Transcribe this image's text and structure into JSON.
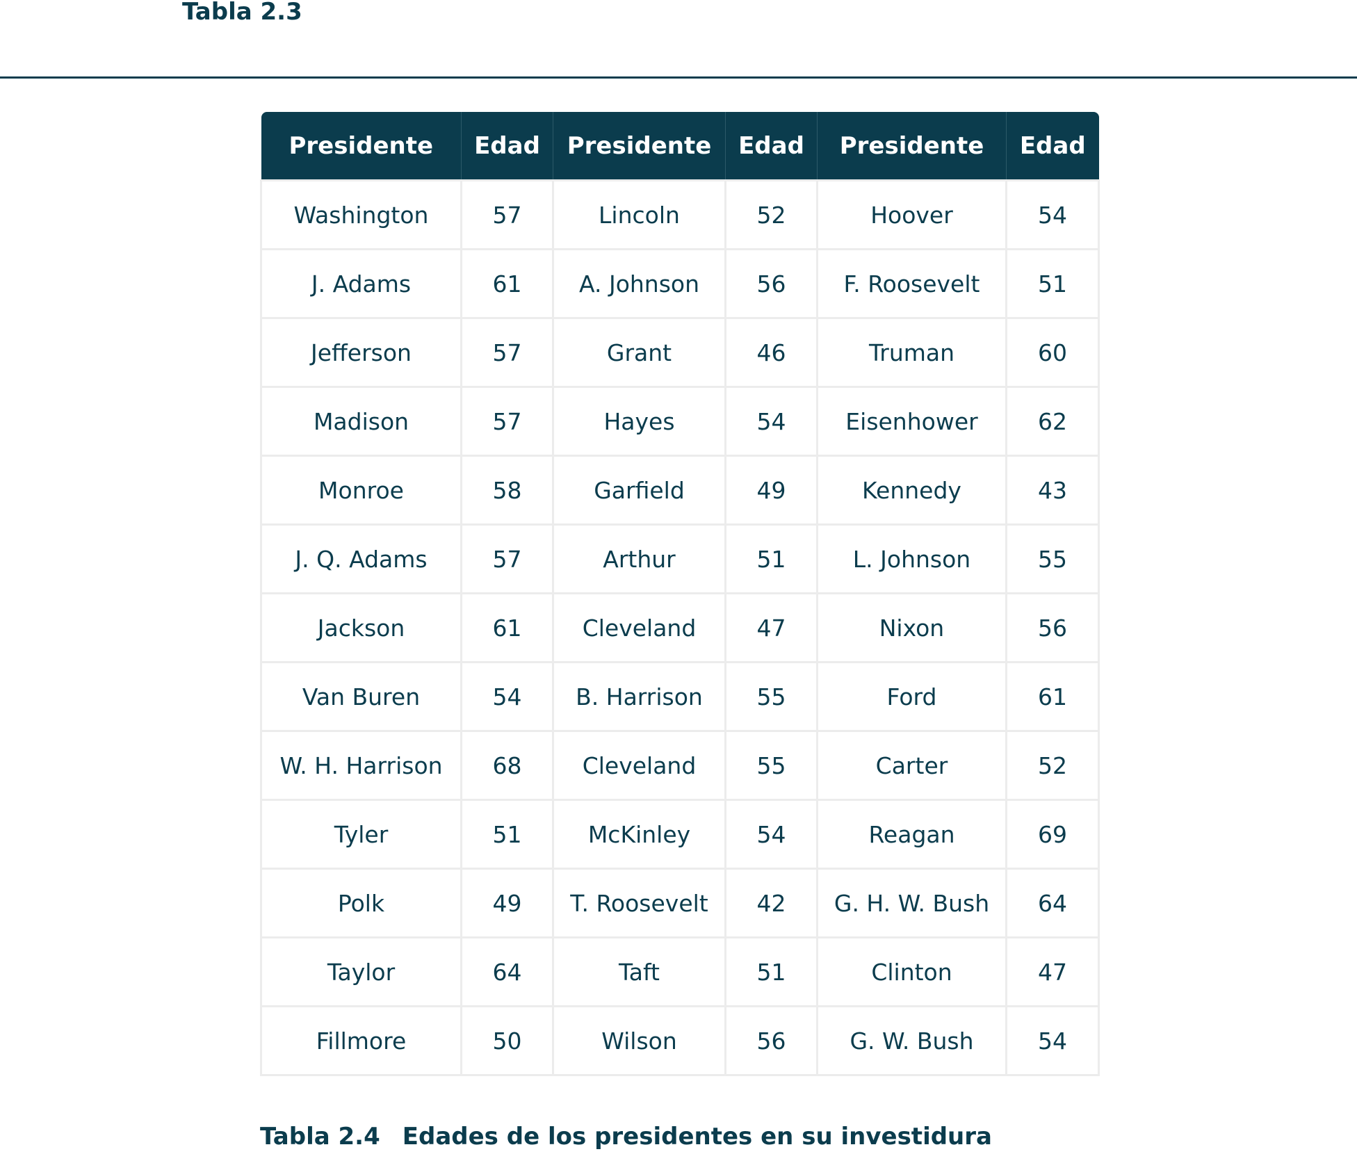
{
  "top_label": "Tabla 2.3",
  "table": {
    "headers": [
      "Presidente",
      "Edad",
      "Presidente",
      "Edad",
      "Presidente",
      "Edad"
    ],
    "rows": [
      [
        "Washington",
        "57",
        "Lincoln",
        "52",
        "Hoover",
        "54"
      ],
      [
        "J. Adams",
        "61",
        "A. Johnson",
        "56",
        "F. Roosevelt",
        "51"
      ],
      [
        "Jefferson",
        "57",
        "Grant",
        "46",
        "Truman",
        "60"
      ],
      [
        "Madison",
        "57",
        "Hayes",
        "54",
        "Eisenhower",
        "62"
      ],
      [
        "Monroe",
        "58",
        "Garfield",
        "49",
        "Kennedy",
        "43"
      ],
      [
        "J. Q. Adams",
        "57",
        "Arthur",
        "51",
        "L. Johnson",
        "55"
      ],
      [
        "Jackson",
        "61",
        "Cleveland",
        "47",
        "Nixon",
        "56"
      ],
      [
        "Van Buren",
        "54",
        "B. Harrison",
        "55",
        "Ford",
        "61"
      ],
      [
        "W. H. Harrison",
        "68",
        "Cleveland",
        "55",
        "Carter",
        "52"
      ],
      [
        "Tyler",
        "51",
        "McKinley",
        "54",
        "Reagan",
        "69"
      ],
      [
        "Polk",
        "49",
        "T. Roosevelt",
        "42",
        "G. H. W. Bush",
        "64"
      ],
      [
        "Taylor",
        "64",
        "Taft",
        "51",
        "Clinton",
        "47"
      ],
      [
        "Fillmore",
        "50",
        "Wilson",
        "56",
        "G. W. Bush",
        "54"
      ]
    ]
  },
  "caption": {
    "number": "Tabla 2.4",
    "text": "Edades de los presidentes en su investidura"
  }
}
